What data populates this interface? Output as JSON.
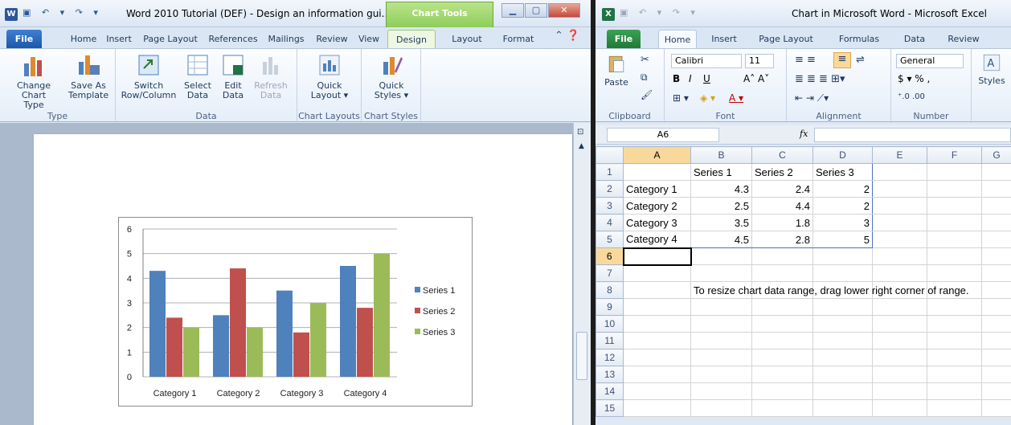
{
  "word": {
    "title": "Word 2010 Tutorial (DEF) - Design an information gui...",
    "context_tab": "Chart Tools",
    "tabs": [
      "File",
      "Home",
      "Insert",
      "Page Layout",
      "References",
      "Mailings",
      "Review",
      "View",
      "Design",
      "Layout",
      "Format"
    ],
    "active_tab": "Design",
    "groups": {
      "type": {
        "label": "Type",
        "change_chart_type": [
          "Change",
          "Chart Type"
        ],
        "save_as_template": [
          "Save As",
          "Template"
        ]
      },
      "data": {
        "label": "Data",
        "switch": [
          "Switch",
          "Row/Column"
        ],
        "select": [
          "Select",
          "Data"
        ],
        "edit": [
          "Edit",
          "Data"
        ],
        "refresh": [
          "Refresh",
          "Data"
        ]
      },
      "layouts": {
        "label": "Chart Layouts",
        "quick_layout": [
          "Quick",
          "Layout ▾"
        ]
      },
      "styles": {
        "label": "Chart Styles",
        "quick_styles": [
          "Quick",
          "Styles ▾"
        ]
      }
    }
  },
  "chart_data": {
    "type": "bar",
    "categories": [
      "Category 1",
      "Category 2",
      "Category 3",
      "Category 4"
    ],
    "series": [
      {
        "name": "Series 1",
        "values": [
          4.3,
          2.5,
          3.5,
          4.5
        ],
        "color": "#4f81bd"
      },
      {
        "name": "Series 2",
        "values": [
          2.4,
          4.4,
          1.8,
          2.8
        ],
        "color": "#c0504d"
      },
      {
        "name": "Series 3",
        "values": [
          2,
          2,
          3,
          5
        ],
        "color": "#9bbb59"
      }
    ],
    "ylim": [
      0,
      6
    ],
    "yticks": [
      "0",
      "1",
      "2",
      "3",
      "4",
      "5",
      "6"
    ],
    "grid": true,
    "legend": "right"
  },
  "excel": {
    "title": "Chart in Microsoft Word  -  Microsoft Excel",
    "tabs": [
      "File",
      "Home",
      "Insert",
      "Page Layout",
      "Formulas",
      "Data",
      "Review"
    ],
    "active_tab": "Home",
    "font_name": "Calibri",
    "font_size": "11",
    "number_format": "General",
    "group_labels": {
      "clipboard": "Clipboard",
      "font": "Font",
      "alignment": "Alignment",
      "number": "Number"
    },
    "paste": "Paste",
    "styles": "Styles",
    "name_box": "A6",
    "fx": "fx",
    "columns": [
      "",
      "A",
      "B",
      "C",
      "D",
      "E",
      "F",
      "G"
    ],
    "rows": [
      [
        "1",
        "",
        "Series 1",
        "Series 2",
        "Series 3",
        "",
        "",
        ""
      ],
      [
        "2",
        "Category 1",
        "4.3",
        "2.4",
        "2",
        "",
        "",
        ""
      ],
      [
        "3",
        "Category 2",
        "2.5",
        "4.4",
        "2",
        "",
        "",
        ""
      ],
      [
        "4",
        "Category 3",
        "3.5",
        "1.8",
        "3",
        "",
        "",
        ""
      ],
      [
        "5",
        "Category 4",
        "4.5",
        "2.8",
        "5",
        "",
        "",
        ""
      ],
      [
        "6",
        "",
        "",
        "",
        "",
        "",
        "",
        ""
      ],
      [
        "7",
        "",
        "",
        "",
        "",
        "",
        "",
        ""
      ],
      [
        "8",
        "",
        "To resize chart data range, drag lower right corner of range.",
        "",
        "",
        "",
        "",
        ""
      ],
      [
        "9",
        "",
        "",
        "",
        "",
        "",
        "",
        ""
      ],
      [
        "10",
        "",
        "",
        "",
        "",
        "",
        "",
        ""
      ],
      [
        "11",
        "",
        "",
        "",
        "",
        "",
        "",
        ""
      ],
      [
        "12",
        "",
        "",
        "",
        "",
        "",
        "",
        ""
      ],
      [
        "13",
        "",
        "",
        "",
        "",
        "",
        "",
        ""
      ],
      [
        "14",
        "",
        "",
        "",
        "",
        "",
        "",
        ""
      ],
      [
        "15",
        "",
        "",
        "",
        "",
        "",
        "",
        ""
      ]
    ]
  }
}
